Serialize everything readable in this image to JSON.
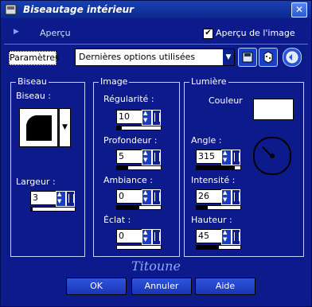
{
  "window": {
    "title": "Biseautage intérieur"
  },
  "preview": {
    "label": "Aperçu",
    "checkbox_label": "Aperçu de l'image",
    "checkbox_mark": "✔"
  },
  "presets": {
    "label": "Paramètres",
    "value": "Dernières options utilisées"
  },
  "groups": {
    "biseau": {
      "title": "Biseau",
      "label": "Biseau :",
      "width_label": "Largeur :",
      "width_value": "3"
    },
    "image": {
      "title": "Image",
      "smoothness_label": "Régularité :",
      "smoothness_value": "10",
      "depth_label": "Profondeur :",
      "depth_value": "5",
      "ambiance_label": "Ambiance :",
      "ambiance_value": "0",
      "shine_label": "Éclat :",
      "shine_value": "0"
    },
    "lumiere": {
      "title": "Lumière",
      "color_label": "Couleur",
      "angle_label": "Angle :",
      "angle_value": "315",
      "intensity_label": "Intensité :",
      "intensity_value": "26",
      "height_label": "Hauteur :",
      "height_value": "45"
    }
  },
  "signature": "Titoune",
  "buttons": {
    "ok": "OK",
    "cancel": "Annuler",
    "help": "Aide"
  },
  "colors": {
    "panel": "#0c1a8c",
    "title": "#0b2a8f",
    "button": "#1a35b8"
  }
}
